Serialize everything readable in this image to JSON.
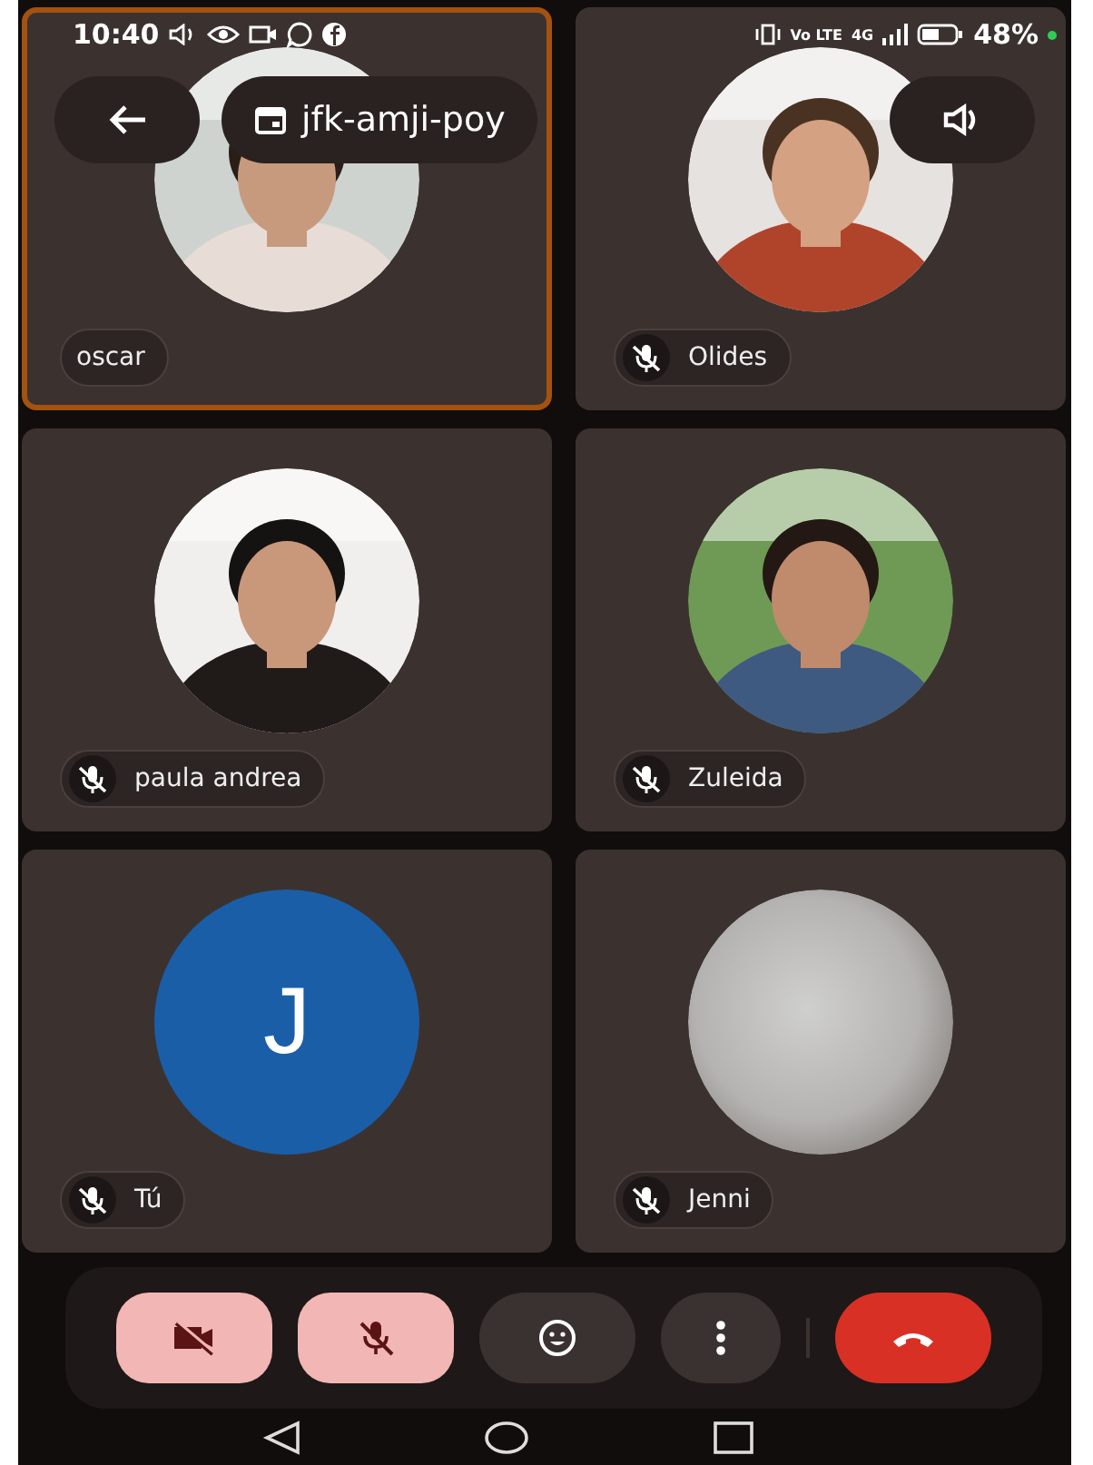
{
  "status_bar": {
    "time": "10:40",
    "volte": "Vo LTE",
    "network": "4G",
    "battery": "48%"
  },
  "header": {
    "meeting_code": "jfk-amji-poy"
  },
  "participants": [
    {
      "name": "oscar",
      "muted": false,
      "speaking": true
    },
    {
      "name": "Olides",
      "muted": true,
      "speaking": false
    },
    {
      "name": "paula andrea",
      "muted": true,
      "speaking": false
    },
    {
      "name": "Zuleida",
      "muted": true,
      "speaking": false
    },
    {
      "name": "Tú",
      "muted": true,
      "speaking": false,
      "avatar": {
        "kind": "initial",
        "initial": "J",
        "color": "#1a5ea8"
      }
    },
    {
      "name": "Jenni",
      "muted": true,
      "speaking": false,
      "avatar": {
        "kind": "blurred"
      }
    }
  ],
  "controls": [
    {
      "kind": "camera",
      "off": true
    },
    {
      "kind": "mic",
      "off": true
    },
    {
      "kind": "reactions"
    },
    {
      "kind": "more"
    },
    {
      "kind": "end_call"
    }
  ]
}
